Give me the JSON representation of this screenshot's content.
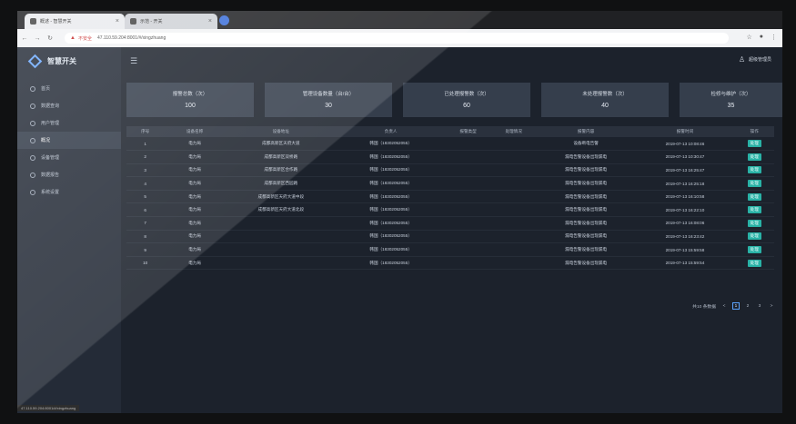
{
  "browser": {
    "tabs": [
      {
        "title": "概述 - 智慧开关"
      },
      {
        "title": "示范 - 开关"
      }
    ],
    "security_label": "不安全",
    "url": "47.110.59.204:8001/#/xingzhuang",
    "status_url": "47.110.59.204:8001/#/xingzhuang"
  },
  "app": {
    "brand": "智慧开关",
    "user": "超级管理员",
    "sidebar": {
      "items": [
        {
          "label": "首页",
          "icon": "home-icon",
          "active": false
        },
        {
          "label": "数据查询",
          "icon": "search-icon",
          "active": false
        },
        {
          "label": "用户管理",
          "icon": "user-icon",
          "active": false
        },
        {
          "label": "概况",
          "icon": "chart-icon",
          "active": true
        },
        {
          "label": "设备管理",
          "icon": "device-icon",
          "active": false
        },
        {
          "label": "数据报告",
          "icon": "report-icon",
          "active": false
        },
        {
          "label": "系统设置",
          "icon": "gear-icon",
          "active": false
        }
      ]
    },
    "stats": [
      {
        "label": "报警总数（次）",
        "value": "100"
      },
      {
        "label": "管理设备数量（台/台）",
        "value": "30"
      },
      {
        "label": "已处理报警数（次）",
        "value": "60"
      },
      {
        "label": "未处理报警数（次）",
        "value": "40"
      },
      {
        "label": "检修与维护（次）",
        "value": "35"
      }
    ],
    "table": {
      "headers": [
        "序号",
        "设备名称",
        "设备地址",
        "负责人",
        "报警类型",
        "处理情况",
        "报警内容",
        "报警时间",
        "操作"
      ],
      "action_label": "处理",
      "rows": [
        [
          "1",
          "电力局",
          "成都高新区天府大道",
          "韩国（18302052055）",
          "",
          "",
          "设备断电告警",
          "2019-07-13 10:08:46",
          "处理"
        ],
        [
          "2",
          "电力局",
          "成都高新区双桥路",
          "韩国（18302052055）",
          "",
          "",
          "漏电告警设备出现漏电",
          "2019-07-13 10:30:47",
          "处理"
        ],
        [
          "3",
          "电力局",
          "成都高新区合作路",
          "韩国（18302052055）",
          "",
          "",
          "漏电告警设备出现漏电",
          "2019-07-13 16:25:47",
          "处理"
        ],
        [
          "4",
          "电力局",
          "成都高新区西园路",
          "韩国（18302052055）",
          "",
          "",
          "漏电告警设备出现漏电",
          "2019-07-13 16:25:18",
          "处理"
        ],
        [
          "5",
          "电力局",
          "成都高新区天府大道中段",
          "韩国（18302052055）",
          "",
          "",
          "漏电告警设备出现漏电",
          "2019-07-13 16:10:58",
          "处理"
        ],
        [
          "6",
          "电力局",
          "成都高新区天府大道北段",
          "韩国（18302052055）",
          "",
          "",
          "漏电告警设备出现漏电",
          "2019-07-13 16:22:10",
          "处理"
        ],
        [
          "7",
          "电力局",
          "",
          "韩国（18302052055）",
          "",
          "",
          "漏电告警设备出现漏电",
          "2019-07-13 16:08:06",
          "处理"
        ],
        [
          "8",
          "电力局",
          "",
          "韩国（18302052055）",
          "",
          "",
          "漏电告警设备出现漏电",
          "2019-07-13 16:23:42",
          "处理"
        ],
        [
          "9",
          "电力局",
          "",
          "韩国（18302052055）",
          "",
          "",
          "漏电告警设备出现漏电",
          "2019-07-13 15:59:58",
          "处理"
        ],
        [
          "10",
          "电力局",
          "",
          "韩国（18302052055）",
          "",
          "",
          "漏电告警设备出现漏电",
          "2019-07-13 15:59:54",
          "处理"
        ]
      ]
    },
    "pagination": {
      "total_label": "共10 条数据",
      "pages": [
        "1",
        "2",
        "3"
      ],
      "current": "1",
      "prev": "<",
      "next": ">"
    }
  },
  "colors": {
    "accent": "#29b2a6",
    "sidebar_bg": "#242b37",
    "main_bg": "#1c222c",
    "card_bg": "#353e4c",
    "link_blue": "#5aa3ff"
  }
}
